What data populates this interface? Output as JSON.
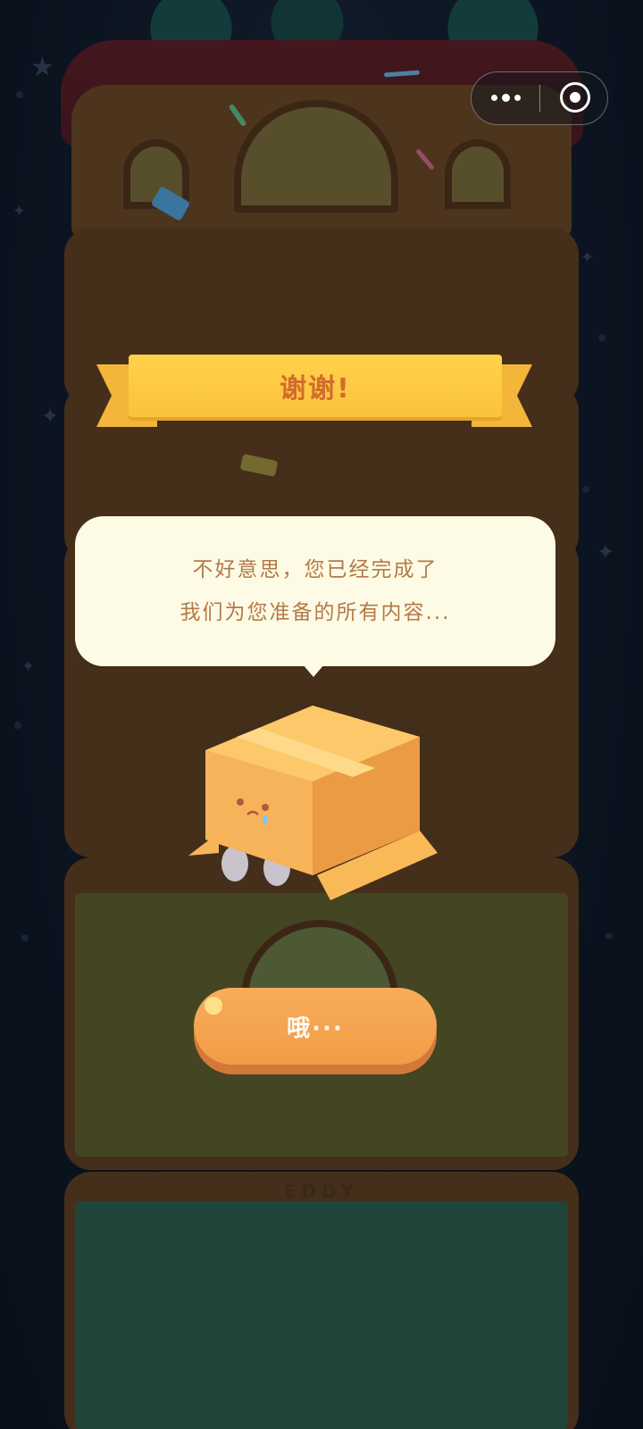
{
  "capsule": {
    "more_icon": "more-dots-icon",
    "close_icon": "close-target-icon"
  },
  "ribbon": {
    "title": "谢谢!"
  },
  "message": {
    "line1": "不好意思，您已经完成了",
    "line2": "我们为您准备的所有内容..."
  },
  "button": {
    "label": "哦···"
  },
  "scene": {
    "tower_sign": "EDDY",
    "character": "cardboard-box-cat-icon"
  },
  "colors": {
    "ribbon": "#fcc23c",
    "ribbon_text": "#d36b2d",
    "bubble": "#fdfbe6",
    "bubble_text": "#b47a47",
    "button": "#f29c47",
    "background": "#101a29"
  }
}
